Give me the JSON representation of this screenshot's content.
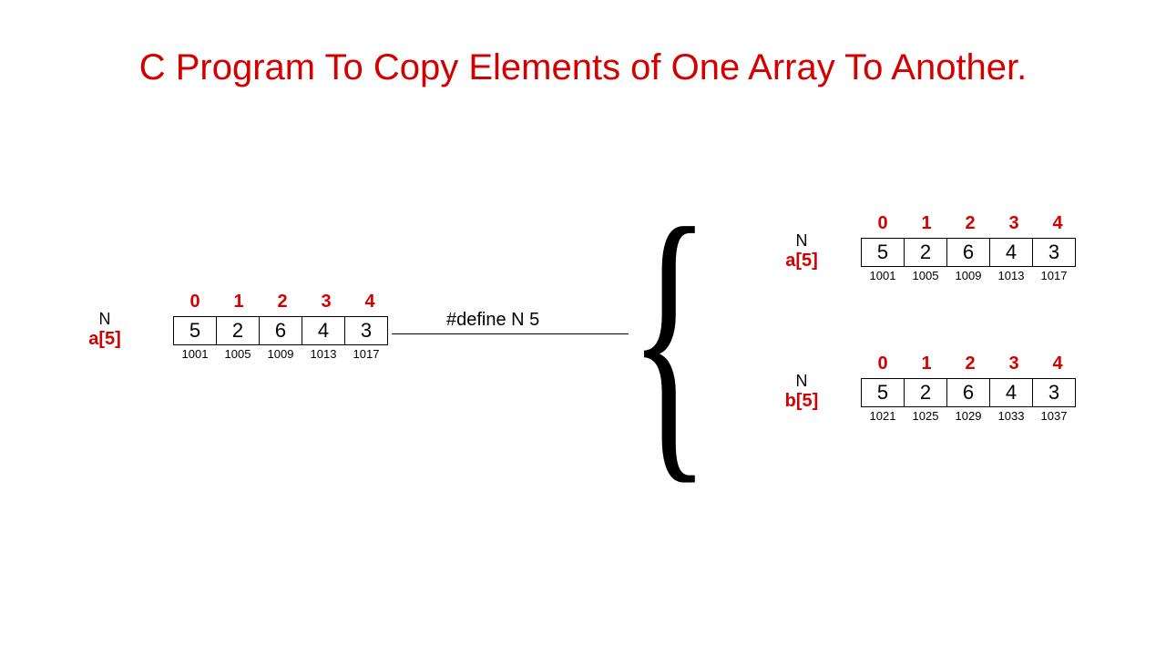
{
  "title": "C Program To Copy Elements of One Array To Another.",
  "define_text": "#define N 5",
  "left_array": {
    "n_label": "N",
    "name": "a[5]",
    "indices": [
      "0",
      "1",
      "2",
      "3",
      "4"
    ],
    "values": [
      "5",
      "2",
      "6",
      "4",
      "3"
    ],
    "addresses": [
      "1001",
      "1005",
      "1009",
      "1013",
      "1017"
    ]
  },
  "right_top": {
    "n_label": "N",
    "name": "a[5]",
    "indices": [
      "0",
      "1",
      "2",
      "3",
      "4"
    ],
    "values": [
      "5",
      "2",
      "6",
      "4",
      "3"
    ],
    "addresses": [
      "1001",
      "1005",
      "1009",
      "1013",
      "1017"
    ]
  },
  "right_bottom": {
    "n_label": "N",
    "name": "b[5]",
    "indices": [
      "0",
      "1",
      "2",
      "3",
      "4"
    ],
    "values": [
      "5",
      "2",
      "6",
      "4",
      "3"
    ],
    "addresses": [
      "1021",
      "1025",
      "1029",
      "1033",
      "1037"
    ]
  },
  "brace": "{"
}
